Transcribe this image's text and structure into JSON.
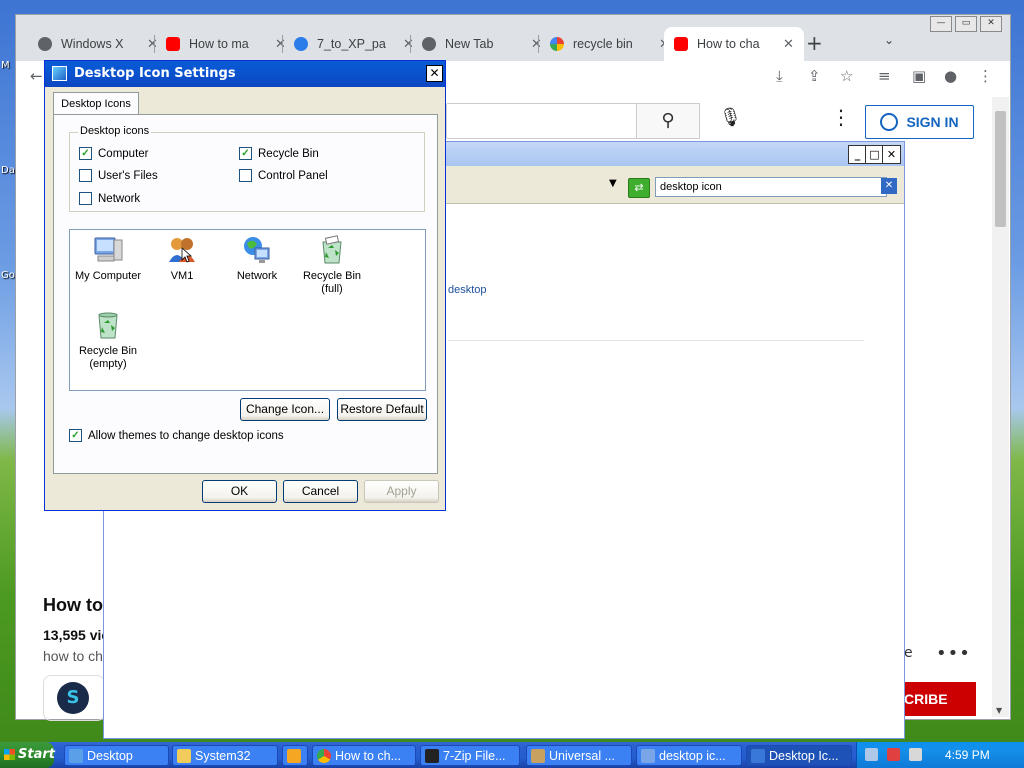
{
  "desktop": {
    "edge_labels": [
      "M",
      "Da",
      "Go"
    ]
  },
  "chrome": {
    "tabs": [
      {
        "title": "Windows X",
        "icon": "globe-icon"
      },
      {
        "title": "How to ma",
        "icon": "youtube-icon"
      },
      {
        "title": "7_to_XP_pa",
        "icon": "edge-icon"
      },
      {
        "title": "New Tab",
        "icon": "chrome-icon"
      },
      {
        "title": "recycle bin",
        "icon": "google-icon"
      },
      {
        "title": "How to cha",
        "icon": "youtube-icon",
        "active": true
      }
    ],
    "new_tab": "+",
    "youtube": {
      "sign_in": "SIGN IN",
      "video_title": "How to",
      "views": "13,595 vie",
      "description": "how to ch",
      "channel_initial": "S",
      "subscribe": "CRIBE",
      "more_label": "e",
      "more_dots": "•••"
    }
  },
  "search_window": {
    "search_value": "desktop icon",
    "result_link": "desktop"
  },
  "dialog": {
    "title": "Desktop Icon Settings",
    "tab": "Desktop Icons",
    "group_label": "Desktop icons",
    "checkboxes": [
      {
        "label": "Computer",
        "checked": true
      },
      {
        "label": "Recycle Bin",
        "checked": true
      },
      {
        "label": "User's Files",
        "checked": false
      },
      {
        "label": "Control Panel",
        "checked": false
      },
      {
        "label": "Network",
        "checked": false
      }
    ],
    "icons": [
      {
        "label": "My Computer",
        "icon": "my-computer-icon"
      },
      {
        "label": "VM1",
        "icon": "user-files-icon"
      },
      {
        "label": "Network",
        "icon": "network-icon"
      },
      {
        "label": "Recycle Bin (full)",
        "line1": "Recycle Bin",
        "line2": "(full)",
        "icon": "recycle-bin-full-icon"
      },
      {
        "label": "Recycle Bin (empty)",
        "line1": "Recycle Bin",
        "line2": "(empty)",
        "icon": "recycle-bin-empty-icon"
      }
    ],
    "change_icon": "Change Icon...",
    "restore_default": "Restore Default",
    "allow_themes": {
      "label": "Allow themes to change desktop icons",
      "checked": true
    },
    "ok": "OK",
    "cancel": "Cancel",
    "apply": "Apply"
  },
  "taskbar": {
    "start": "Start",
    "tasks": [
      {
        "label": "Desktop",
        "icon": "desktop-icon"
      },
      {
        "label": "System32",
        "icon": "folder-icon"
      },
      {
        "label": "",
        "icon": "media-icon"
      },
      {
        "label": "How to ch...",
        "icon": "chrome-icon"
      },
      {
        "label": "7-Zip File...",
        "icon": "7zip-icon"
      },
      {
        "label": "Universal ...",
        "icon": "universal-icon"
      },
      {
        "label": "desktop ic...",
        "icon": "search-icon"
      },
      {
        "label": "Desktop Ic...",
        "icon": "display-icon",
        "active": true
      }
    ],
    "clock": "4:59 PM"
  },
  "colors": {
    "xp_title_blue": "#0a54d0",
    "dialog_face": "#ece9d8",
    "youtube_red": "#cc0000",
    "signin_blue": "#1565c0"
  }
}
